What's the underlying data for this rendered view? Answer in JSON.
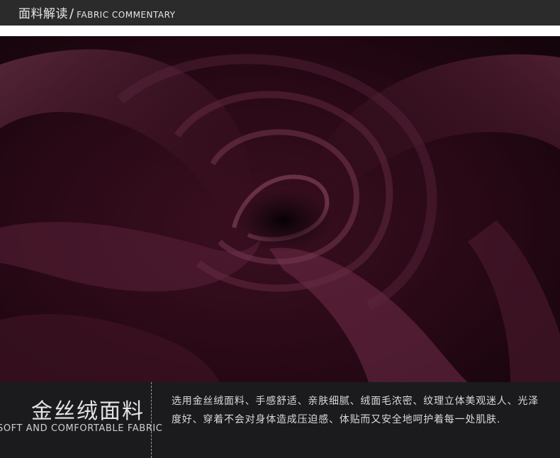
{
  "header": {
    "title_zh": "面料解读",
    "separator": "/",
    "title_en": "FABRIC COMMENTARY"
  },
  "colors": {
    "header_bg": "#2b2b2b",
    "fabric": "#4a1a2c",
    "footer_bg": "#1b1b1d"
  },
  "footer": {
    "fabric_name": "金丝绒面料",
    "fabric_tagline": "SOFT AND COMFORTABLE FABRIC",
    "description": "选用金丝绒面料、手感舒适、亲肤细腻、绒面毛浓密、纹理立体美观迷人、光泽度好、穿着不会对身体造成压迫感、体贴而又安全地呵护着每一处肌肤."
  }
}
